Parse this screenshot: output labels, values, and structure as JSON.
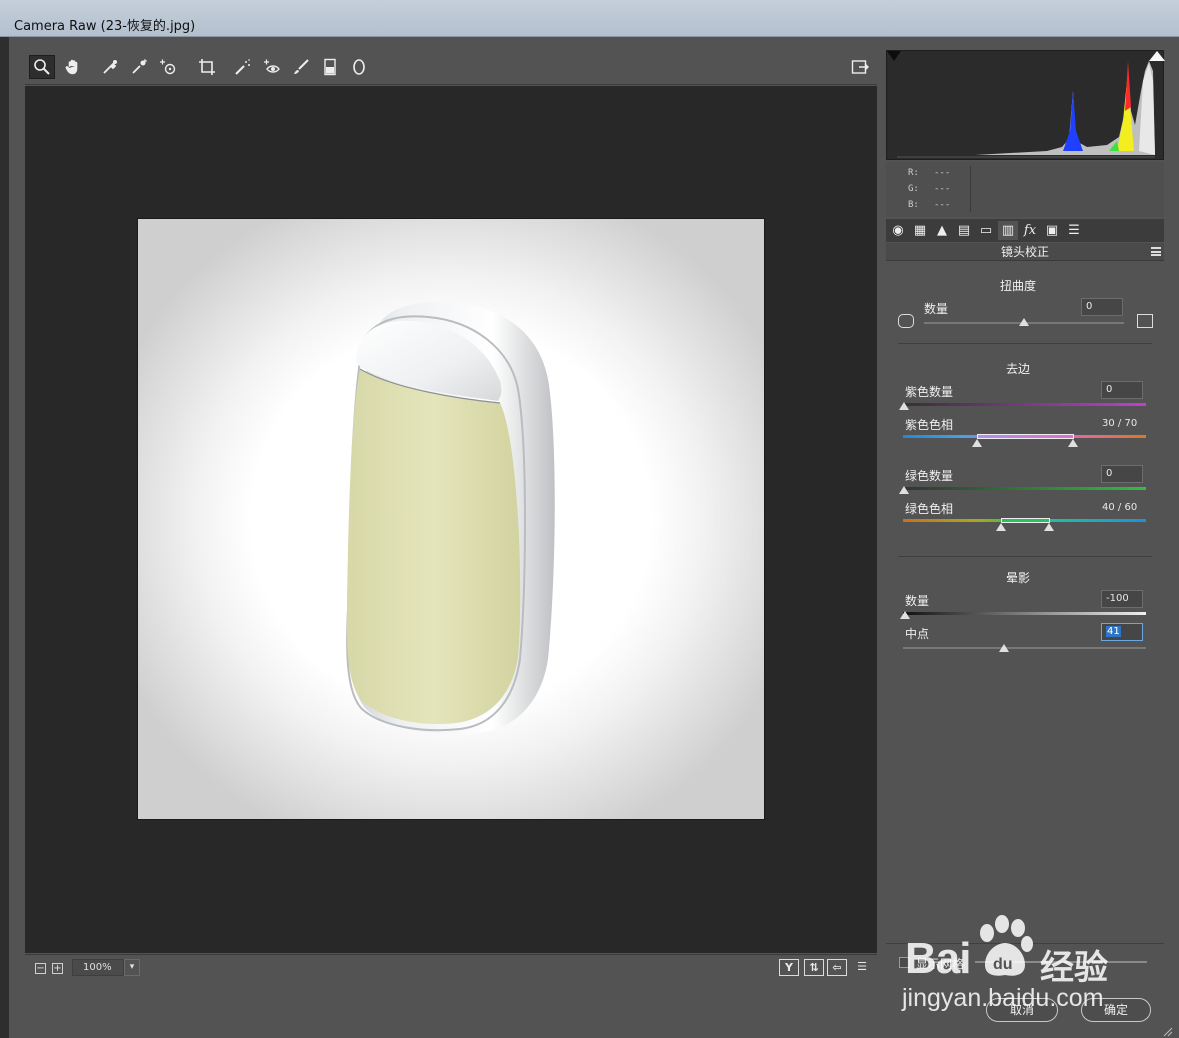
{
  "window": {
    "title": "Camera Raw (23-恢复的.jpg)"
  },
  "toolbar": {
    "tools": [
      "zoom-icon",
      "hand-icon",
      "white-balance-icon",
      "color-sampler-icon",
      "targeted-adjustment-icon",
      "crop-icon",
      "spot-removal-icon",
      "red-eye-icon",
      "brush-icon",
      "graduated-filter-icon",
      "radial-filter-icon"
    ],
    "open_preferences": "preferences-icon"
  },
  "status": {
    "zoom": "100%",
    "zoom_out": "−",
    "zoom_in": "+",
    "view_y": "Y"
  },
  "readout": {
    "r_label": "R:",
    "g_label": "G:",
    "b_label": "B:",
    "r": "---",
    "g": "---",
    "b": "---"
  },
  "panel": {
    "title": "镜头校正",
    "distortion": {
      "section": "扭曲度",
      "amount_label": "数量",
      "amount": "0"
    },
    "defringe": {
      "section": "去边",
      "purple_amount_label": "紫色数量",
      "purple_amount": "0",
      "purple_hue_label": "紫色色相",
      "purple_hue": "30 / 70",
      "green_amount_label": "绿色数量",
      "green_amount": "0",
      "green_hue_label": "绿色色相",
      "green_hue": "40 / 60"
    },
    "vignetting": {
      "section": "晕影",
      "amount_label": "数量",
      "amount": "-100",
      "midpoint_label": "中点",
      "midpoint": "41"
    }
  },
  "bottom": {
    "show_grid_label": "显示网格",
    "cancel": "取消",
    "ok": "确定"
  },
  "watermark": {
    "brand": "Bai",
    "brand2": "经验",
    "url": "jingyan.baidu.com"
  },
  "colors": {
    "panel": "#535353",
    "preview_bg": "#282828",
    "accent_blue": "#2f75c7"
  }
}
